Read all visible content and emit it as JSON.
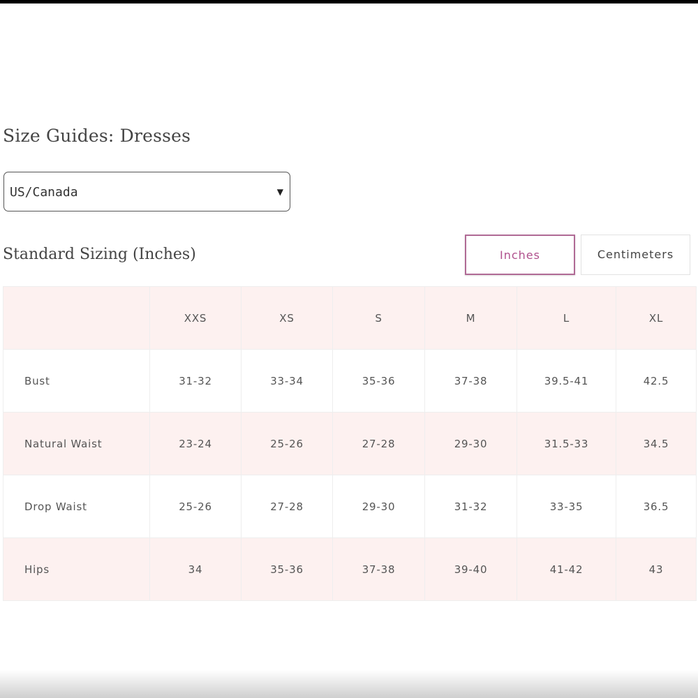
{
  "page_title": "Size Guides: Dresses",
  "region_select": {
    "selected": "US/Canada"
  },
  "section_title": "Standard Sizing (Inches)",
  "unit_toggle": {
    "inches": "Inches",
    "centimeters": "Centimeters",
    "active": "inches",
    "active_color": "#b0508d"
  },
  "size_table": {
    "header_corner": "",
    "sizes": [
      "XXS",
      "XS",
      "S",
      "M",
      "L",
      "XL"
    ],
    "rows": [
      {
        "label": "Bust",
        "values": [
          "31-32",
          "33-34",
          "35-36",
          "37-38",
          "39.5-41",
          "42.5"
        ]
      },
      {
        "label": "Natural Waist",
        "values": [
          "23-24",
          "25-26",
          "27-28",
          "29-30",
          "31.5-33",
          "34.5"
        ]
      },
      {
        "label": "Drop Waist",
        "values": [
          "25-26",
          "27-28",
          "29-30",
          "31-32",
          "33-35",
          "36.5"
        ]
      },
      {
        "label": "Hips",
        "values": [
          "34",
          "35-36",
          "37-38",
          "39-40",
          "41-42",
          "43"
        ]
      }
    ],
    "shade_color": "#fdf1f0"
  }
}
